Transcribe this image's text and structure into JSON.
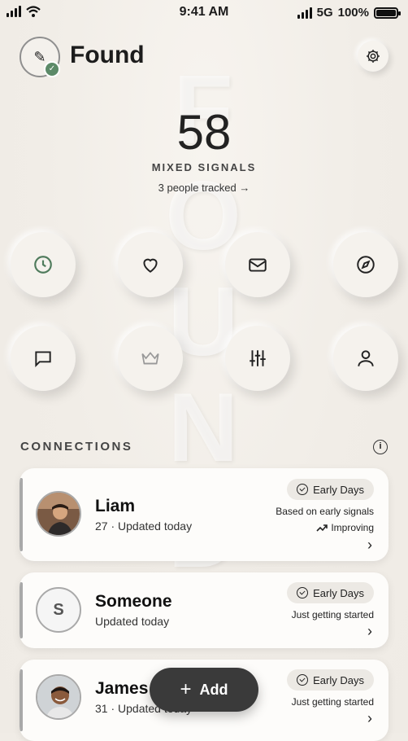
{
  "status": {
    "time": "9:41 AM",
    "network": "5G",
    "battery": "100%"
  },
  "app": {
    "title": "Found",
    "background_letters": "F O U N D"
  },
  "summary": {
    "score": "58",
    "label": "MIXED SIGNALS",
    "tracked": "3 people tracked →"
  },
  "actions": [
    {
      "name": "history-button",
      "icon": "clock-icon"
    },
    {
      "name": "favorites-button",
      "icon": "heart-icon"
    },
    {
      "name": "messages-button",
      "icon": "mail-icon"
    },
    {
      "name": "explore-button",
      "icon": "compass-icon"
    },
    {
      "name": "chat-button",
      "icon": "chat-icon"
    },
    {
      "name": "premium-button",
      "icon": "crown-icon"
    },
    {
      "name": "filters-button",
      "icon": "sliders-icon"
    },
    {
      "name": "profile-button",
      "icon": "person-icon"
    }
  ],
  "connections": {
    "section_title": "CONNECTIONS",
    "items": [
      {
        "name": "Liam",
        "sub": "27 · Updated today",
        "badge": "Early Days",
        "note": "Based on early signals",
        "trend": "Improving",
        "avatar": "photo"
      },
      {
        "name": "Someone",
        "sub": "Updated today",
        "badge": "Early Days",
        "note": "Just getting started",
        "trend": "",
        "avatar_initial": "S"
      },
      {
        "name": "James",
        "sub": "31 · Updated today",
        "badge": "Early Days",
        "note": "Just getting started",
        "trend": "",
        "avatar": "photo"
      }
    ]
  },
  "fab": {
    "label": "Add"
  },
  "colors": {
    "accent_green": "#5c8a68",
    "fab_bg": "#3a3a3a",
    "badge_bg": "#ece9e4"
  }
}
